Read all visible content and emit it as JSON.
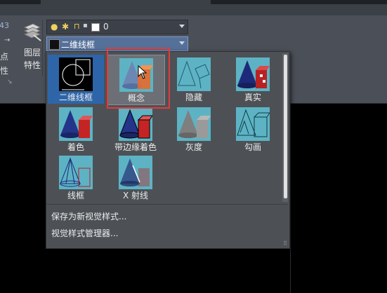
{
  "ribbon": {
    "left_fragment": {
      "number": "43",
      "label_top": "点",
      "label_bottom": "性"
    },
    "layers_button": {
      "line1": "图层",
      "line2": "特性"
    },
    "layer_combo": {
      "value": "0"
    },
    "visual_style_combo": {
      "value": "二维线框"
    }
  },
  "visual_styles": {
    "tiles": [
      {
        "label": "二维线框",
        "icon": "wireframe-2d-icon"
      },
      {
        "label": "概念",
        "icon": "conceptual-icon"
      },
      {
        "label": "隐藏",
        "icon": "hidden-icon"
      },
      {
        "label": "真实",
        "icon": "realistic-icon"
      },
      {
        "label": "着色",
        "icon": "shaded-icon"
      },
      {
        "label": "带边缘着色",
        "icon": "shaded-with-edges-icon"
      },
      {
        "label": "灰度",
        "icon": "grayscale-icon"
      },
      {
        "label": "勾画",
        "icon": "sketchy-icon"
      },
      {
        "label": "线框",
        "icon": "wireframe-icon"
      },
      {
        "label": "X 射线",
        "icon": "xray-icon"
      }
    ],
    "menu": {
      "save_as": "保存为新视觉样式...",
      "manager": "视觉样式管理器..."
    }
  },
  "colors": {
    "thumb_bg": "#5db3c4",
    "selected_bg": "#2e65a8",
    "highlight_box": "#e53a3a"
  }
}
